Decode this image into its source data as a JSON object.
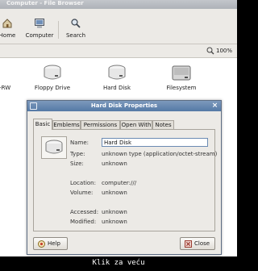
{
  "browser": {
    "title": "Computer - File Browser",
    "toolbar": {
      "home_label": "Home",
      "computer_label": "Computer",
      "search_label": "Search"
    },
    "zoom": "100%",
    "items": [
      {
        "label": "CD-RW"
      },
      {
        "label": "Floppy Drive"
      },
      {
        "label": "Hard Disk"
      },
      {
        "label": "Filesystem"
      }
    ]
  },
  "dialog": {
    "title": "Hard Disk Properties",
    "tabs": [
      "Basic",
      "Emblems",
      "Permissions",
      "Open With",
      "Notes"
    ],
    "active_tab": "Basic",
    "name_label": "Name:",
    "name_value": "Hard Disk",
    "properties": [
      {
        "label": "Type:",
        "value": "unknown type (application/octet-stream)"
      },
      {
        "label": "Size:",
        "value": "unknown"
      },
      {
        "label": "Location:",
        "value": "computer:///"
      },
      {
        "label": "Volume:",
        "value": "unknown"
      },
      {
        "label": "Accessed:",
        "value": "unknown"
      },
      {
        "label": "Modified:",
        "value": "unknown"
      }
    ],
    "help_label": "Help",
    "close_label": "Close"
  },
  "caption": "Klik za veću",
  "colors": {
    "titlebar": "#5479a6",
    "window_bg": "#eceae6",
    "caption_bg": "#000000"
  }
}
